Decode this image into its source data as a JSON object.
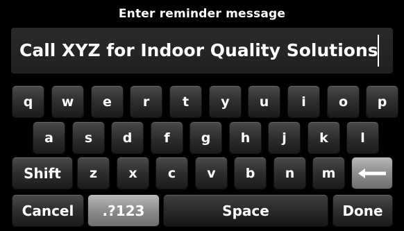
{
  "header": {
    "title": "Enter reminder message"
  },
  "message": {
    "value": "Call XYZ for Indoor Quality Solutions"
  },
  "keyboard": {
    "row1": [
      "q",
      "w",
      "e",
      "r",
      "t",
      "y",
      "u",
      "i",
      "o",
      "p"
    ],
    "row2": [
      "a",
      "s",
      "d",
      "f",
      "g",
      "h",
      "j",
      "k",
      "l"
    ],
    "row3": [
      "z",
      "x",
      "c",
      "v",
      "b",
      "n",
      "m"
    ],
    "shift_label": "Shift",
    "backspace_icon": "left-arrow-icon",
    "cancel_label": "Cancel",
    "symbols_label": ".?123",
    "space_label": "Space",
    "done_label": "Done"
  },
  "colors": {
    "background": "#000000",
    "key_dark": "#303030",
    "key_light": "#8d8d8d",
    "text": "#ffffff"
  }
}
